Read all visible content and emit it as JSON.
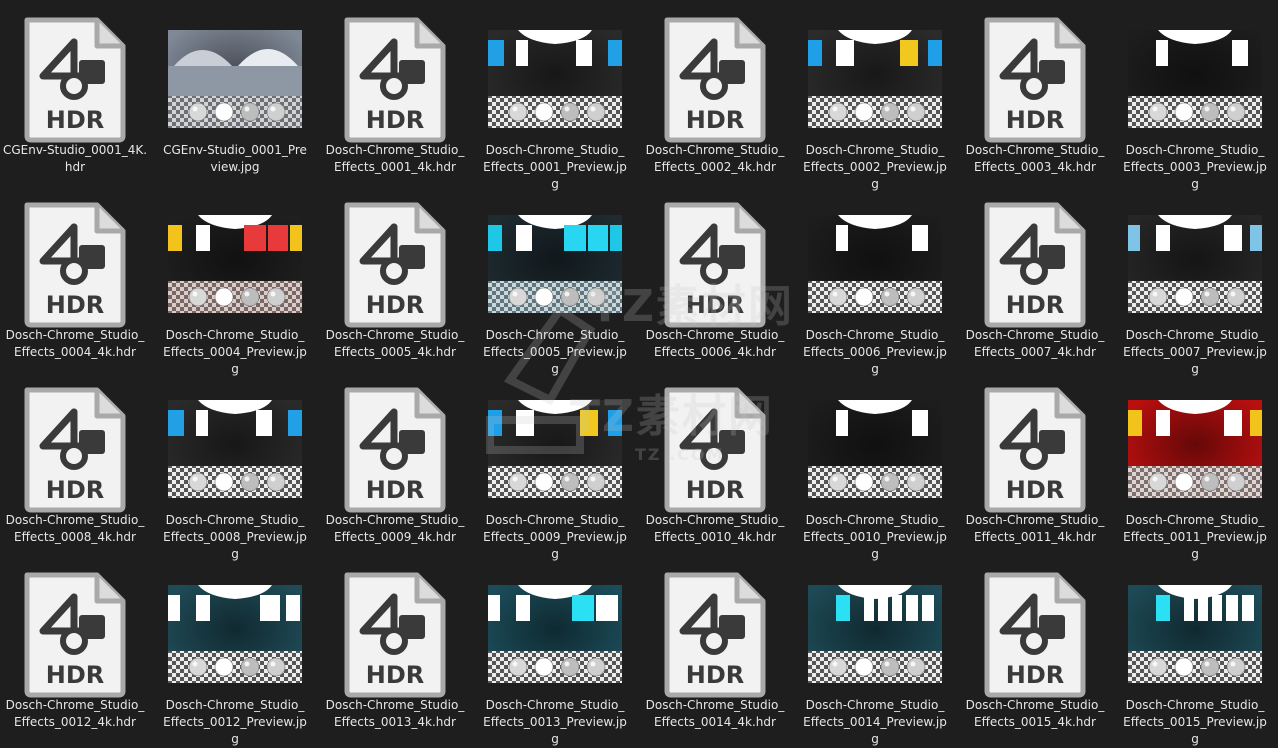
{
  "colors": {
    "background": "#1e1e1e",
    "label_text": "#e6e6e6",
    "icon_paper": "#f2f2f2",
    "icon_border": "#a9a9a9",
    "icon_glyph": "#3a3a3a"
  },
  "icon_text": "HDR",
  "watermark": {
    "line1": "TZ素材网",
    "line2": "TZ素材网",
    "line3": "TZ   .COM"
  },
  "files": [
    {
      "name": "CGEnv-Studio_0001_4K.hdr",
      "kind": "hdr"
    },
    {
      "name": "CGEnv-Studio_0001_Preview.jpg",
      "kind": "preview",
      "theme": "cgenv"
    },
    {
      "name": "Dosch-Chrome_Studio_Effects_0001_4k.hdr",
      "kind": "hdr"
    },
    {
      "name": "Dosch-Chrome_Studio_Effects_0001_Preview.jpg",
      "kind": "preview",
      "theme": "blue-white"
    },
    {
      "name": "Dosch-Chrome_Studio_Effects_0002_4k.hdr",
      "kind": "hdr"
    },
    {
      "name": "Dosch-Chrome_Studio_Effects_0002_Preview.jpg",
      "kind": "preview",
      "theme": "blue-yellow"
    },
    {
      "name": "Dosch-Chrome_Studio_Effects_0003_4k.hdr",
      "kind": "hdr"
    },
    {
      "name": "Dosch-Chrome_Studio_Effects_0003_Preview.jpg",
      "kind": "preview",
      "theme": "white-dark"
    },
    {
      "name": "Dosch-Chrome_Studio_Effects_0004_4k.hdr",
      "kind": "hdr"
    },
    {
      "name": "Dosch-Chrome_Studio_Effects_0004_Preview.jpg",
      "kind": "preview",
      "theme": "yellow-red"
    },
    {
      "name": "Dosch-Chrome_Studio_Effects_0005_4k.hdr",
      "kind": "hdr"
    },
    {
      "name": "Dosch-Chrome_Studio_Effects_0005_Preview.jpg",
      "kind": "preview",
      "theme": "cyan"
    },
    {
      "name": "Dosch-Chrome_Studio_Effects_0006_4k.hdr",
      "kind": "hdr"
    },
    {
      "name": "Dosch-Chrome_Studio_Effects_0006_Preview.jpg",
      "kind": "preview",
      "theme": "white-dark"
    },
    {
      "name": "Dosch-Chrome_Studio_Effects_0007_4k.hdr",
      "kind": "hdr"
    },
    {
      "name": "Dosch-Chrome_Studio_Effects_0007_Preview.jpg",
      "kind": "preview",
      "theme": "paleblue-white"
    },
    {
      "name": "Dosch-Chrome_Studio_Effects_0008_4k.hdr",
      "kind": "hdr"
    },
    {
      "name": "Dosch-Chrome_Studio_Effects_0008_Preview.jpg",
      "kind": "preview",
      "theme": "blue-white"
    },
    {
      "name": "Dosch-Chrome_Studio_Effects_0009_4k.hdr",
      "kind": "hdr"
    },
    {
      "name": "Dosch-Chrome_Studio_Effects_0009_Preview.jpg",
      "kind": "preview",
      "theme": "blue-yellow"
    },
    {
      "name": "Dosch-Chrome_Studio_Effects_0010_4k.hdr",
      "kind": "hdr"
    },
    {
      "name": "Dosch-Chrome_Studio_Effects_0010_Preview.jpg",
      "kind": "preview",
      "theme": "white-dark"
    },
    {
      "name": "Dosch-Chrome_Studio_Effects_0011_4k.hdr",
      "kind": "hdr"
    },
    {
      "name": "Dosch-Chrome_Studio_Effects_0011_Preview.jpg",
      "kind": "preview",
      "theme": "red-yellow"
    },
    {
      "name": "Dosch-Chrome_Studio_Effects_0012_4k.hdr",
      "kind": "hdr"
    },
    {
      "name": "Dosch-Chrome_Studio_Effects_0012_Preview.jpg",
      "kind": "preview",
      "theme": "teal-white"
    },
    {
      "name": "Dosch-Chrome_Studio_Effects_0013_4k.hdr",
      "kind": "hdr"
    },
    {
      "name": "Dosch-Chrome_Studio_Effects_0013_Preview.jpg",
      "kind": "preview",
      "theme": "teal-cyan"
    },
    {
      "name": "Dosch-Chrome_Studio_Effects_0014_4k.hdr",
      "kind": "hdr"
    },
    {
      "name": "Dosch-Chrome_Studio_Effects_0014_Preview.jpg",
      "kind": "preview",
      "theme": "teal-cyan-many"
    },
    {
      "name": "Dosch-Chrome_Studio_Effects_0015_4k.hdr",
      "kind": "hdr"
    },
    {
      "name": "Dosch-Chrome_Studio_Effects_0015_Preview.jpg",
      "kind": "preview",
      "theme": "teal-cyan-many"
    }
  ]
}
